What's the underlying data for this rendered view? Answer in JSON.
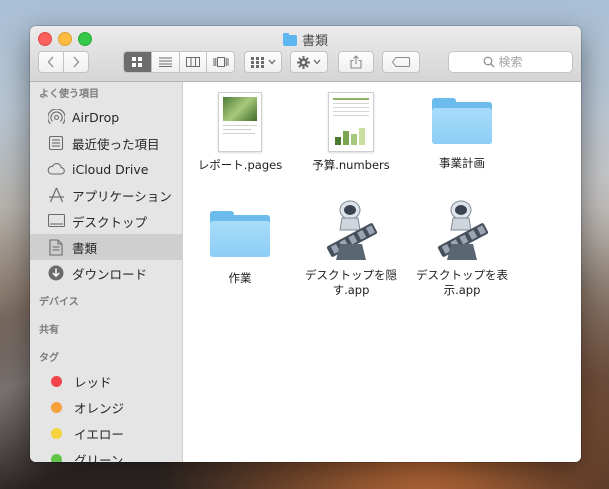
{
  "window": {
    "title": "書類"
  },
  "toolbar": {
    "back_icon": "chevron-left-icon",
    "forward_icon": "chevron-right-icon",
    "search_placeholder": "検索"
  },
  "sidebar": {
    "favorites_header": "よく使う項目",
    "favorites": [
      {
        "label": "AirDrop",
        "icon": "airdrop-icon"
      },
      {
        "label": "最近使った項目",
        "icon": "recents-icon"
      },
      {
        "label": "iCloud Drive",
        "icon": "cloud-icon"
      },
      {
        "label": "アプリケーション",
        "icon": "applications-icon"
      },
      {
        "label": "デスクトップ",
        "icon": "desktop-icon"
      },
      {
        "label": "書類",
        "icon": "documents-icon",
        "selected": true
      },
      {
        "label": "ダウンロード",
        "icon": "download-icon"
      }
    ],
    "devices_header": "デバイス",
    "shared_header": "共有",
    "tags_header": "タグ",
    "tags": [
      {
        "label": "レッド",
        "color": "#f2444b"
      },
      {
        "label": "オレンジ",
        "color": "#f6a03a"
      },
      {
        "label": "イエロー",
        "color": "#f4d33c"
      },
      {
        "label": "グリーン",
        "color": "#62c54a"
      }
    ]
  },
  "files": [
    {
      "name": "レポート.pages",
      "kind": "pages-document"
    },
    {
      "name": "予算.numbers",
      "kind": "numbers-document"
    },
    {
      "name": "事業計画",
      "kind": "folder"
    },
    {
      "name": "作業",
      "kind": "folder"
    },
    {
      "name": "デスクトップを隠す.app",
      "kind": "automator-app"
    },
    {
      "name": "デスクトップを表示.app",
      "kind": "automator-app"
    }
  ]
}
